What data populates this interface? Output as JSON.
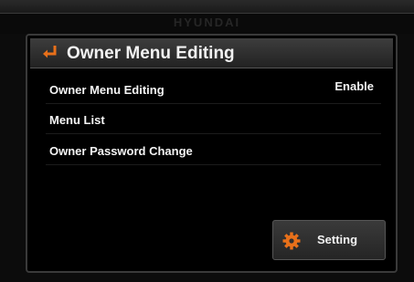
{
  "brand": "HYUNDAI",
  "header": {
    "title": "Owner Menu Editing",
    "back_icon": "back-arrow-icon",
    "accent_color": "#e8701a"
  },
  "menu": {
    "items": [
      {
        "label": "Owner Menu Editing",
        "value": "Enable"
      },
      {
        "label": "Menu List"
      },
      {
        "label": "Owner Password Change"
      }
    ]
  },
  "setting_button": {
    "label": "Setting",
    "icon": "gear-icon"
  }
}
